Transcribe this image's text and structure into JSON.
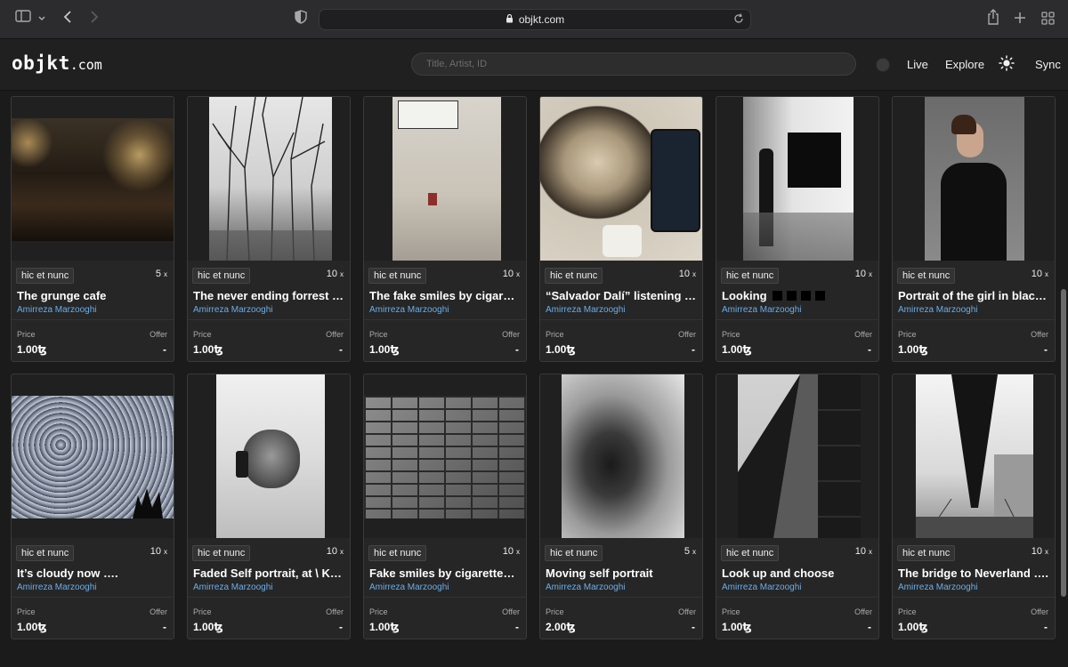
{
  "browser": {
    "url": "objkt.com"
  },
  "site": {
    "logo_main": "objkt",
    "logo_suffix": ".com",
    "search_placeholder": "Title, Artist, ID",
    "nav": {
      "live": "Live",
      "explore": "Explore",
      "sync": "Sync"
    }
  },
  "card_labels": {
    "price": "Price",
    "offer": "Offer"
  },
  "cards": [
    {
      "platform": "hic et nunc",
      "editions": "5",
      "title": "The grunge cafe",
      "artist": "Amirreza Marzooghi",
      "price": "1.00ꜩ",
      "offer": "-"
    },
    {
      "platform": "hic et nunc",
      "editions": "10",
      "title": "The never ending forrest …",
      "artist": "Amirreza Marzooghi",
      "price": "1.00ꜩ",
      "offer": "-"
    },
    {
      "platform": "hic et nunc",
      "editions": "10",
      "title": "The fake smiles by cigaret…",
      "artist": "Amirreza Marzooghi",
      "price": "1.00ꜩ",
      "offer": "-"
    },
    {
      "platform": "hic et nunc",
      "editions": "10",
      "title": "“Salvador Dalí” listening t…",
      "artist": "Amirreza Marzooghi",
      "price": "1.00ꜩ",
      "offer": "-"
    },
    {
      "platform": "hic et nunc",
      "editions": "10",
      "title": "Looking",
      "artist": "Amirreza Marzooghi",
      "price": "1.00ꜩ",
      "offer": "-"
    },
    {
      "platform": "hic et nunc",
      "editions": "10",
      "title": "Portrait of the girl in black…",
      "artist": "Amirreza Marzooghi",
      "price": "1.00ꜩ",
      "offer": "-"
    },
    {
      "platform": "hic et nunc",
      "editions": "10",
      "title": "It’s cloudy now ….",
      "artist": "Amirreza Marzooghi",
      "price": "1.00ꜩ",
      "offer": "-"
    },
    {
      "platform": "hic et nunc",
      "editions": "10",
      "title": "Faded Self portrait, at \\ Ka…",
      "artist": "Amirreza Marzooghi",
      "price": "1.00ꜩ",
      "offer": "-"
    },
    {
      "platform": "hic et nunc",
      "editions": "10",
      "title": "Fake smiles by cigarettes …",
      "artist": "Amirreza Marzooghi",
      "price": "1.00ꜩ",
      "offer": "-"
    },
    {
      "platform": "hic et nunc",
      "editions": "5",
      "title": "Moving self portrait",
      "artist": "Amirreza Marzooghi",
      "price": "2.00ꜩ",
      "offer": "-"
    },
    {
      "platform": "hic et nunc",
      "editions": "10",
      "title": "Look up and choose",
      "artist": "Amirreza Marzooghi",
      "price": "1.00ꜩ",
      "offer": "-"
    },
    {
      "platform": "hic et nunc",
      "editions": "10",
      "title": "The bridge to Neverland ….",
      "artist": "Amirreza Marzooghi",
      "price": "1.00ꜩ",
      "offer": "-"
    }
  ],
  "colors": {
    "artist_link": "#6aaee8",
    "card_bg": "#262626",
    "page_bg": "#1b1b1b"
  }
}
